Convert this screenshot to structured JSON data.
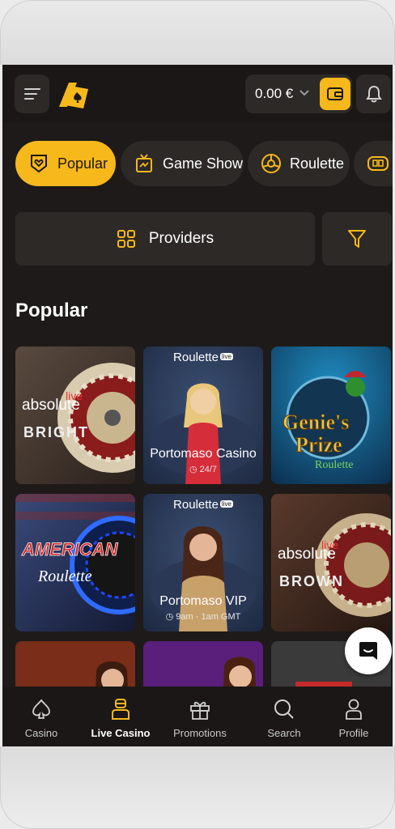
{
  "header": {
    "balance": "0.00 €",
    "icons": [
      "hamburger-menu-icon",
      "brand-logo",
      "chevron-down-icon",
      "wallet-icon",
      "bell-icon"
    ]
  },
  "chips": [
    {
      "label": "Popular",
      "icon": "heart-shield-icon",
      "active": true
    },
    {
      "label": "Game Show",
      "icon": "tv-icon",
      "active": false
    },
    {
      "label": "Roulette",
      "icon": "roulette-wheel-icon",
      "active": false
    },
    {
      "label": "",
      "icon": "cards-icon",
      "active": false
    }
  ],
  "providers": {
    "label": "Providers"
  },
  "section_title": "Popular",
  "games": [
    {
      "brand": "",
      "label": "",
      "sub": ""
    },
    {
      "brand": "Roulette",
      "badge": "live",
      "label": "Portomaso Casino",
      "sub": "24/7"
    },
    {
      "brand": "",
      "label": "",
      "sub": ""
    },
    {
      "brand": "",
      "label": "",
      "sub": ""
    },
    {
      "brand": "Roulette",
      "badge": "live",
      "label": "Portomaso VIP",
      "sub": "9am - 1am GMT"
    },
    {
      "brand": "",
      "label": "",
      "sub": ""
    }
  ],
  "artwork_text": {
    "bright": "absolute live BRIGHT",
    "genies": "Genie's Prize Roulette",
    "american": "AMERICAN Roulette",
    "brown": "absolute live BROWN"
  },
  "bottom_nav": [
    {
      "label": "Casino",
      "icon": "spade-icon",
      "active": false
    },
    {
      "label": "Live Casino",
      "icon": "dealer-icon",
      "active": true
    },
    {
      "label": "Promotions",
      "icon": "gift-icon",
      "active": false
    },
    {
      "label": "Search",
      "icon": "search-icon",
      "active": false
    },
    {
      "label": "Profile",
      "icon": "user-icon",
      "active": false
    }
  ],
  "colors": {
    "accent": "#f7b81b",
    "background": "#1d1a19",
    "surface": "#2c2927"
  }
}
